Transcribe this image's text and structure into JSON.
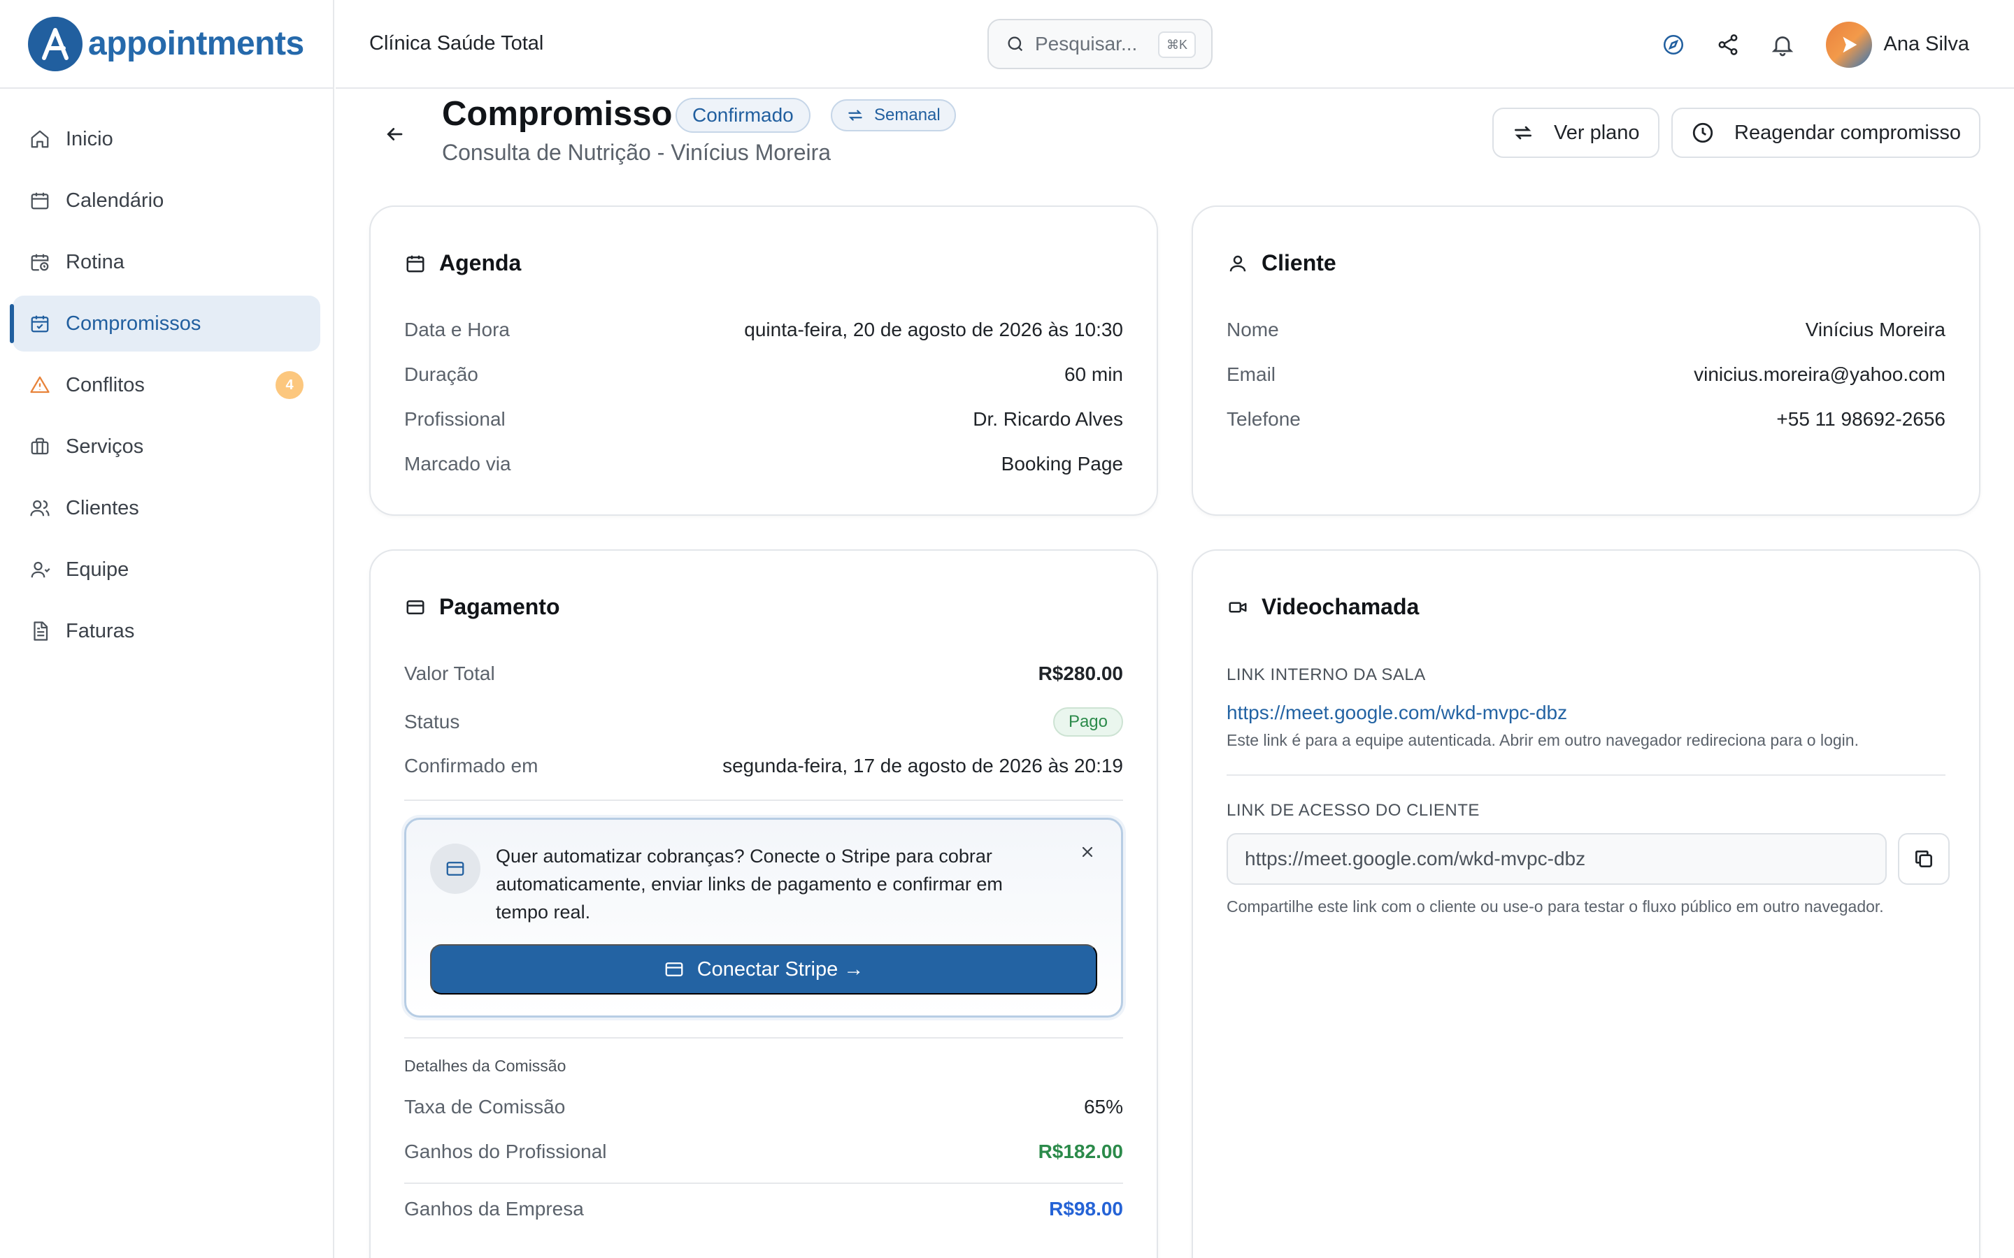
{
  "brand": {
    "name": "appointments",
    "logo_icon": "logo-a-icon"
  },
  "sidebar": {
    "items": [
      {
        "label": "Inicio",
        "icon": "home-icon"
      },
      {
        "label": "Calendário",
        "icon": "calendar-icon"
      },
      {
        "label": "Rotina",
        "icon": "calendar-clock-icon"
      },
      {
        "label": "Compromissos",
        "icon": "calendar-check-icon",
        "active": true
      },
      {
        "label": "Conflitos",
        "icon": "warning-icon",
        "badge": "4"
      },
      {
        "label": "Serviços",
        "icon": "briefcase-icon"
      },
      {
        "label": "Clientes",
        "icon": "users-icon"
      },
      {
        "label": "Equipe",
        "icon": "team-icon"
      },
      {
        "label": "Faturas",
        "icon": "invoice-icon"
      }
    ]
  },
  "topbar": {
    "clinic": "Clínica Saúde Total",
    "search_placeholder": "Pesquisar...",
    "search_shortcut": "⌘K",
    "user_name": "Ana Silva"
  },
  "page": {
    "title": "Compromisso",
    "status": "Confirmado",
    "recurrence": "Semanal",
    "subtitle": "Consulta de Nutrição - Vinícius Moreira",
    "btn_plan": "Ver plano",
    "btn_reschedule": "Reagendar compromisso"
  },
  "agenda": {
    "title": "Agenda",
    "rows": [
      {
        "k": "Data e Hora",
        "v": "quinta-feira, 20 de agosto de 2026 às 10:30"
      },
      {
        "k": "Duração",
        "v": "60 min"
      },
      {
        "k": "Profissional",
        "v": "Dr. Ricardo Alves"
      },
      {
        "k": "Marcado via",
        "v": "Booking Page"
      }
    ]
  },
  "cliente": {
    "title": "Cliente",
    "rows": [
      {
        "k": "Nome",
        "v": "Vinícius Moreira"
      },
      {
        "k": "Email",
        "v": "vinicius.moreira@yahoo.com"
      },
      {
        "k": "Telefone",
        "v": "+55 11 98692-2656"
      }
    ]
  },
  "pagamento": {
    "title": "Pagamento",
    "total_label": "Valor Total",
    "total_value": "R$280.00",
    "status_label": "Status",
    "status_value": "Pago",
    "confirmed_label": "Confirmado em",
    "confirmed_value": "segunda-feira, 17 de agosto de 2026 às 20:19",
    "stripe_text": "Quer automatizar cobranças? Conecte o Stripe para cobrar automaticamente, enviar links de pagamento e confirmar em tempo real.",
    "stripe_button": "Conectar Stripe →",
    "commission_section": "Detalhes da Comissão",
    "commission_rate_label": "Taxa de Comissão",
    "commission_rate_value": "65%",
    "pro_earnings_label": "Ganhos do Profissional",
    "pro_earnings_value": "R$182.00",
    "company_earnings_label": "Ganhos da Empresa",
    "company_earnings_value": "R$98.00"
  },
  "video": {
    "title": "Videochamada",
    "internal_label": "LINK INTERNO DA SALA",
    "internal_link": "https://meet.google.com/wkd-mvpc-dbz",
    "internal_note": "Este link é para a equipe autenticada. Abrir em outro navegador redireciona para o login.",
    "client_label": "LINK DE ACESSO DO CLIENTE",
    "client_link": "https://meet.google.com/wkd-mvpc-dbz",
    "client_note": "Compartilhe este link com o cliente ou use-o para testar o fluxo público em outro navegador."
  },
  "colors": {
    "primary": "#215f9f",
    "success": "#2b8a4a",
    "badge": "#fcc77e",
    "company_value": "#2563d6"
  }
}
